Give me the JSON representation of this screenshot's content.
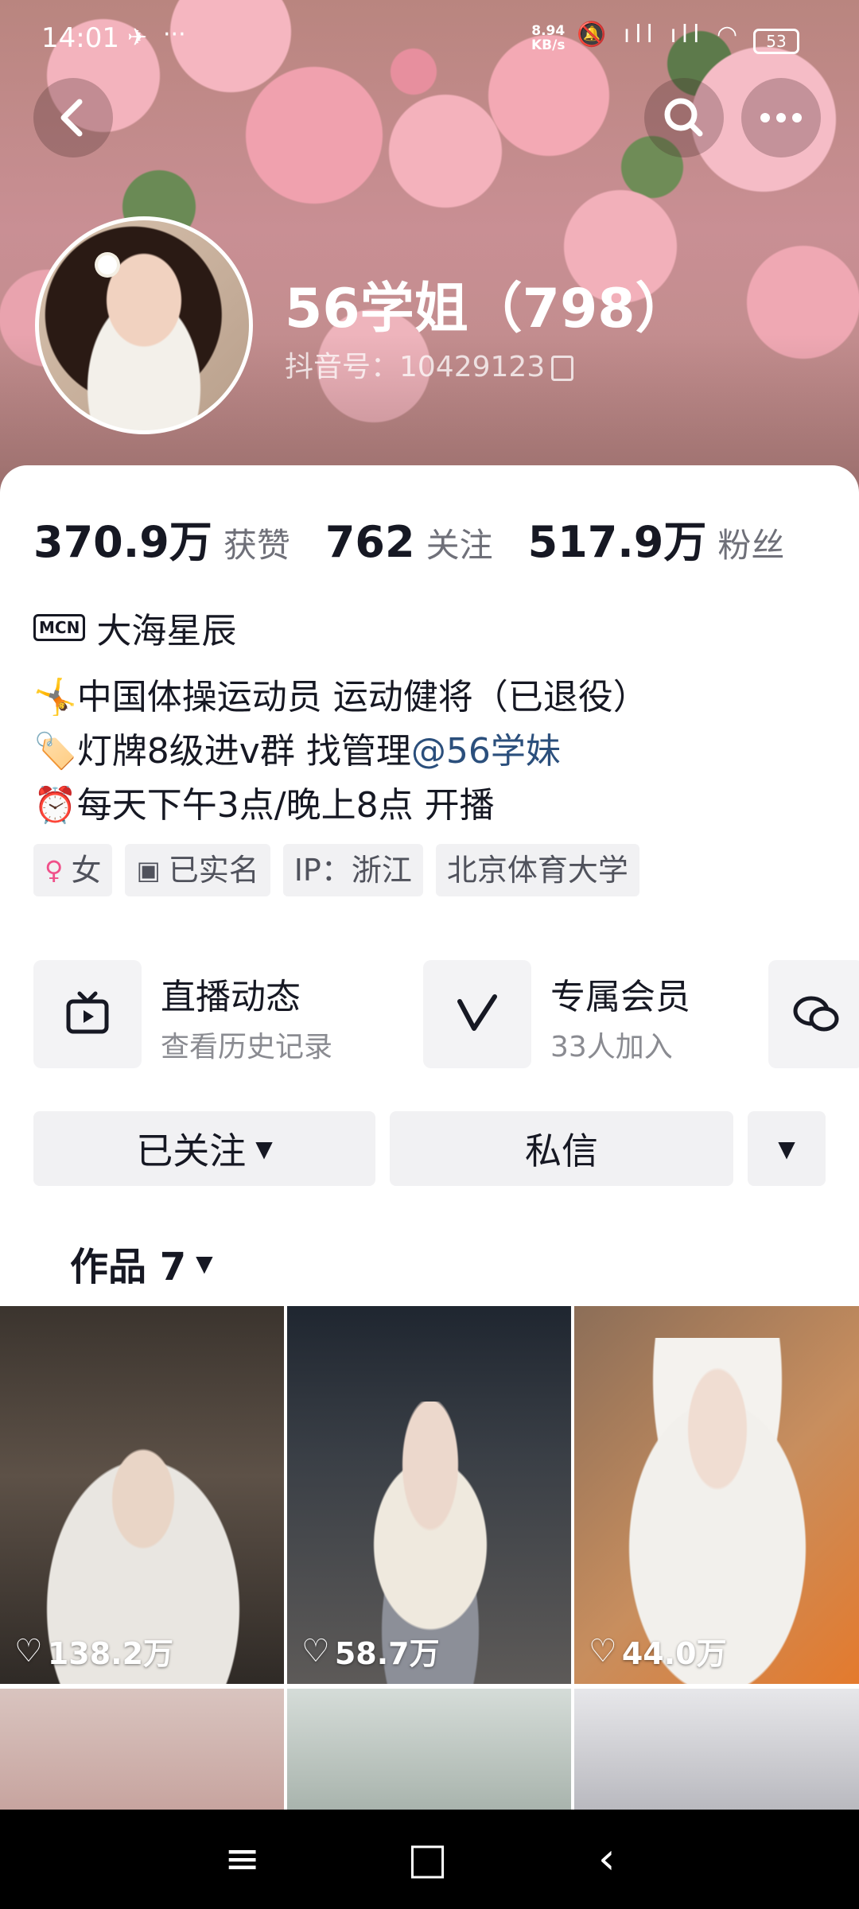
{
  "status_bar": {
    "time": "14:01",
    "net_speed_value": "8.94",
    "net_speed_unit": "KB/s",
    "signal": "HD ıll HD ıll",
    "battery": "53"
  },
  "header": {
    "back_icon": "back-arrow-icon",
    "search_icon": "search-icon",
    "more_icon": "more-dots-icon"
  },
  "profile": {
    "name": "56学姐（798）",
    "douyin_id": "抖音号：10429123"
  },
  "stats": [
    {
      "value": "370.9万",
      "label": "获赞"
    },
    {
      "value": "762",
      "label": "关注"
    },
    {
      "value": "517.9万",
      "label": "粉丝"
    }
  ],
  "mcn": {
    "badge": "MCN",
    "name": "大海星辰"
  },
  "bio": {
    "line1": "中国体操运动员 运动健将（已退役）",
    "line2_prefix": "灯牌8级进v群 找管理",
    "line2_mention": "@56学妹",
    "line3": "每天下午3点/晚上8点 开播"
  },
  "tags": {
    "gender": "女",
    "verified": "已实名",
    "ip": "IP：浙江",
    "school": "北京体育大学"
  },
  "features": {
    "live": {
      "title": "直播动态",
      "subtitle": "查看历史记录"
    },
    "member": {
      "title": "专属会员",
      "subtitle": "33人加入"
    }
  },
  "actions": {
    "follow": "已关注",
    "message": "私信"
  },
  "works": {
    "label": "作品 7"
  },
  "videos": [
    {
      "likes": "138.2万"
    },
    {
      "likes": "58.7万"
    },
    {
      "likes": "44.0万"
    }
  ]
}
